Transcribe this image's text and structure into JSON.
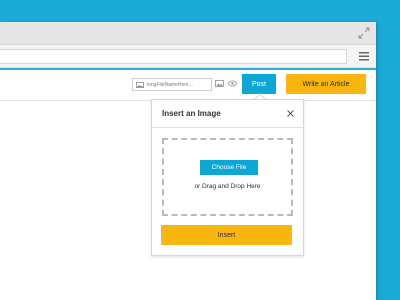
{
  "toolbar": {
    "file_name": "longFileNameHere...",
    "post_label": "Post",
    "write_label": "Write an Article"
  },
  "dialog": {
    "title": "Insert an Image",
    "choose_label": "Choose File",
    "drop_text": "or Drag and Drop Here",
    "insert_label": "Insert"
  },
  "icons": {
    "expand": "expand-icon",
    "menu": "hamburger-menu-icon",
    "image": "image-icon",
    "preview": "eye-icon",
    "close": "close-icon"
  },
  "colors": {
    "background": "#1ba9d6",
    "primary_blue": "#0ea7d4",
    "accent_yellow": "#fbb511"
  }
}
